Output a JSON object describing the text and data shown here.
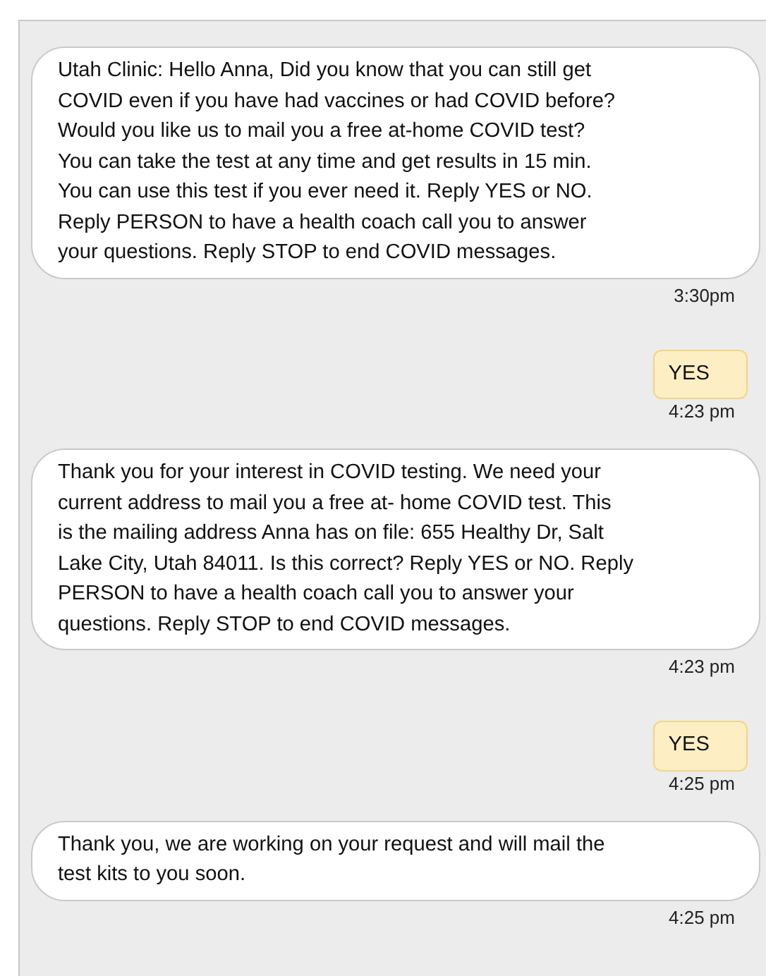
{
  "messages": [
    {
      "kind": "received",
      "text": "Utah Clinic: Hello Anna, Did you know that you can still get\nCOVID even if you have had vaccines or had COVID before?\nWould you like us to mail you a free at-home COVID test?\nYou can take the test at any time and get results in 15 min.\nYou can use this test if you ever need it. Reply YES or NO.\nReply PERSON to have a health coach call you to answer\nyour questions. Reply STOP to end COVID messages.",
      "time": "3:30pm"
    },
    {
      "kind": "sent",
      "text": "YES",
      "time": "4:23 pm"
    },
    {
      "kind": "received",
      "text": "Thank you for your interest in COVID testing. We need your\ncurrent address to mail you a free at- home COVID test. This\nis the mailing address Anna has on file: 655 Healthy Dr, Salt\nLake City, Utah 84011. Is this correct? Reply YES or NO. Reply\nPERSON to have a health coach call you to answer your\nquestions. Reply STOP to end COVID messages.",
      "time": "4:23 pm"
    },
    {
      "kind": "sent",
      "text": "YES",
      "time": "4:25 pm"
    },
    {
      "kind": "received",
      "text": "Thank you, we are working on your request and will mail the\ntest kits to you soon.",
      "time": "4:25 pm"
    }
  ]
}
